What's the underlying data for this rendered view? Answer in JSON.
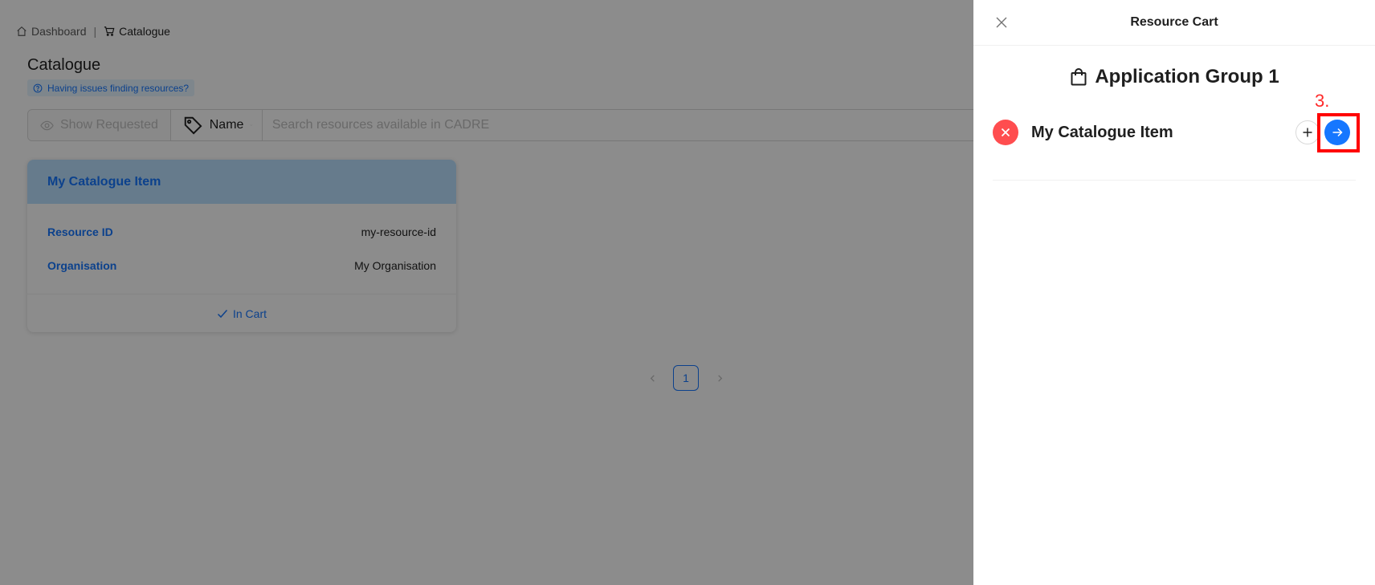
{
  "breadcrumb": {
    "home_label": "Dashboard",
    "separator": "|",
    "current_label": "Catalogue"
  },
  "page": {
    "title": "Catalogue",
    "help_link": "Having issues finding resources?"
  },
  "search": {
    "show_requested_label": "Show Requested",
    "field_selected": "Name",
    "placeholder": "Search resources available in CADRE"
  },
  "card": {
    "title": "My Catalogue Item",
    "rows": [
      {
        "label": "Resource ID",
        "value": "my-resource-id"
      },
      {
        "label": "Organisation",
        "value": "My Organisation"
      }
    ],
    "status": "In Cart"
  },
  "pagination": {
    "current_page": "1"
  },
  "drawer": {
    "title": "Resource Cart",
    "group_title": "Application Group 1",
    "item_name": "My Catalogue Item"
  },
  "annotation": {
    "step_label": "3.",
    "color": "#ff0000"
  },
  "colors": {
    "primary": "#1677ff",
    "danger": "#ff4d4f",
    "card_header_bg": "#bae0ff"
  }
}
